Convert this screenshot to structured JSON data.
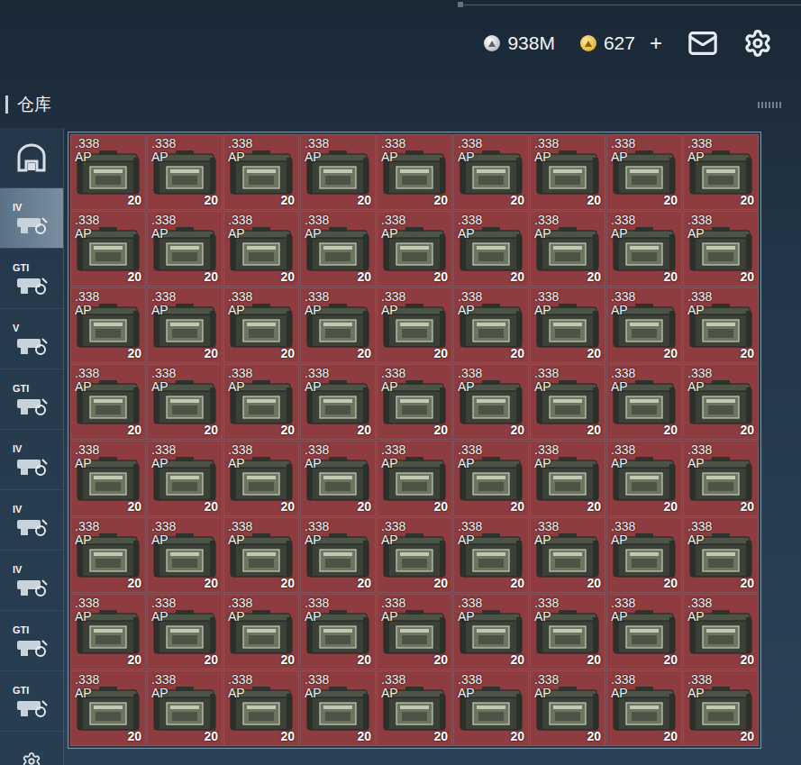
{
  "top_bar": {
    "currencies": [
      {
        "kind": "silver",
        "amount": "938M"
      },
      {
        "kind": "gold",
        "amount": "627"
      }
    ],
    "add_button": "+"
  },
  "title": "仓库",
  "sidebar": {
    "items": [
      {
        "kind": "home",
        "selected": false
      },
      {
        "kind": "tool",
        "label": "IV",
        "selected": true
      },
      {
        "kind": "tool",
        "label": "GTI",
        "selected": false
      },
      {
        "kind": "tool",
        "label": "V",
        "selected": false
      },
      {
        "kind": "tool",
        "label": "GTI",
        "selected": false
      },
      {
        "kind": "tool",
        "label": "IV",
        "selected": false
      },
      {
        "kind": "tool",
        "label": "IV",
        "selected": false
      },
      {
        "kind": "tool",
        "label": "IV",
        "selected": false
      },
      {
        "kind": "tool",
        "label": "GTI",
        "selected": false
      },
      {
        "kind": "tool",
        "label": "GTI",
        "selected": false
      },
      {
        "kind": "settings",
        "selected": false
      }
    ]
  },
  "grid": {
    "items": [
      {
        "caliber": ".338",
        "type": "AP",
        "count": "20"
      },
      {
        "caliber": ".338",
        "type": "AP",
        "count": "20"
      },
      {
        "caliber": ".338",
        "type": "AP",
        "count": "20"
      },
      {
        "caliber": ".338",
        "type": "AP",
        "count": "20"
      },
      {
        "caliber": ".338",
        "type": "AP",
        "count": "20"
      },
      {
        "caliber": ".338",
        "type": "AP",
        "count": "20"
      },
      {
        "caliber": ".338",
        "type": "AP",
        "count": "20"
      },
      {
        "caliber": ".338",
        "type": "AP",
        "count": "20"
      },
      {
        "caliber": ".338",
        "type": "AP",
        "count": "20"
      },
      {
        "caliber": ".338",
        "type": "AP",
        "count": "20"
      },
      {
        "caliber": ".338",
        "type": "AP",
        "count": "20"
      },
      {
        "caliber": ".338",
        "type": "AP",
        "count": "20"
      },
      {
        "caliber": ".338",
        "type": "AP",
        "count": "20"
      },
      {
        "caliber": ".338",
        "type": "AP",
        "count": "20"
      },
      {
        "caliber": ".338",
        "type": "AP",
        "count": "20"
      },
      {
        "caliber": ".338",
        "type": "AP",
        "count": "20"
      },
      {
        "caliber": ".338",
        "type": "AP",
        "count": "20"
      },
      {
        "caliber": ".338",
        "type": "AP",
        "count": "20"
      },
      {
        "caliber": ".338",
        "type": "AP",
        "count": "20"
      },
      {
        "caliber": ".338",
        "type": "AP",
        "count": "20"
      },
      {
        "caliber": ".338",
        "type": "AP",
        "count": "20"
      },
      {
        "caliber": ".338",
        "type": "AP",
        "count": "20"
      },
      {
        "caliber": ".338",
        "type": "AP",
        "count": "20"
      },
      {
        "caliber": ".338",
        "type": "AP",
        "count": "20"
      },
      {
        "caliber": ".338",
        "type": "AP",
        "count": "20"
      },
      {
        "caliber": ".338",
        "type": "AP",
        "count": "20"
      },
      {
        "caliber": ".338",
        "type": "AP",
        "count": "20"
      },
      {
        "caliber": ".338",
        "type": "AP",
        "count": "20"
      },
      {
        "caliber": ".338",
        "type": "AP",
        "count": "20"
      },
      {
        "caliber": ".338",
        "type": "AP",
        "count": "20"
      },
      {
        "caliber": ".338",
        "type": "AP",
        "count": "20"
      },
      {
        "caliber": ".338",
        "type": "AP",
        "count": "20"
      },
      {
        "caliber": ".338",
        "type": "AP",
        "count": "20"
      },
      {
        "caliber": ".338",
        "type": "AP",
        "count": "20"
      },
      {
        "caliber": ".338",
        "type": "AP",
        "count": "20"
      },
      {
        "caliber": ".338",
        "type": "AP",
        "count": "20"
      },
      {
        "caliber": ".338",
        "type": "AP",
        "count": "20"
      },
      {
        "caliber": ".338",
        "type": "AP",
        "count": "20"
      },
      {
        "caliber": ".338",
        "type": "AP",
        "count": "20"
      },
      {
        "caliber": ".338",
        "type": "AP",
        "count": "20"
      },
      {
        "caliber": ".338",
        "type": "AP",
        "count": "20"
      },
      {
        "caliber": ".338",
        "type": "AP",
        "count": "20"
      },
      {
        "caliber": ".338",
        "type": "AP",
        "count": "20"
      },
      {
        "caliber": ".338",
        "type": "AP",
        "count": "20"
      },
      {
        "caliber": ".338",
        "type": "AP",
        "count": "20"
      },
      {
        "caliber": ".338",
        "type": "AP",
        "count": "20"
      },
      {
        "caliber": ".338",
        "type": "AP",
        "count": "20"
      },
      {
        "caliber": ".338",
        "type": "AP",
        "count": "20"
      },
      {
        "caliber": ".338",
        "type": "AP",
        "count": "20"
      },
      {
        "caliber": ".338",
        "type": "AP",
        "count": "20"
      },
      {
        "caliber": ".338",
        "type": "AP",
        "count": "20"
      },
      {
        "caliber": ".338",
        "type": "AP",
        "count": "20"
      },
      {
        "caliber": ".338",
        "type": "AP",
        "count": "20"
      },
      {
        "caliber": ".338",
        "type": "AP",
        "count": "20"
      },
      {
        "caliber": ".338",
        "type": "AP",
        "count": "20"
      },
      {
        "caliber": ".338",
        "type": "AP",
        "count": "20"
      },
      {
        "caliber": ".338",
        "type": "AP",
        "count": "20"
      },
      {
        "caliber": ".338",
        "type": "AP",
        "count": "20"
      },
      {
        "caliber": ".338",
        "type": "AP",
        "count": "20"
      },
      {
        "caliber": ".338",
        "type": "AP",
        "count": "20"
      },
      {
        "caliber": ".338",
        "type": "AP",
        "count": "20"
      },
      {
        "caliber": ".338",
        "type": "AP",
        "count": "20"
      },
      {
        "caliber": ".338",
        "type": "AP",
        "count": "20"
      },
      {
        "caliber": ".338",
        "type": "AP",
        "count": "20"
      },
      {
        "caliber": ".338",
        "type": "AP",
        "count": "20"
      },
      {
        "caliber": ".338",
        "type": "AP",
        "count": "20"
      },
      {
        "caliber": ".338",
        "type": "AP",
        "count": "20"
      },
      {
        "caliber": ".338",
        "type": "AP",
        "count": "20"
      },
      {
        "caliber": ".338",
        "type": "AP",
        "count": "20"
      },
      {
        "caliber": ".338",
        "type": "AP",
        "count": "20"
      },
      {
        "caliber": ".338",
        "type": "AP",
        "count": "20"
      },
      {
        "caliber": ".338",
        "type": "AP",
        "count": "20"
      }
    ]
  }
}
